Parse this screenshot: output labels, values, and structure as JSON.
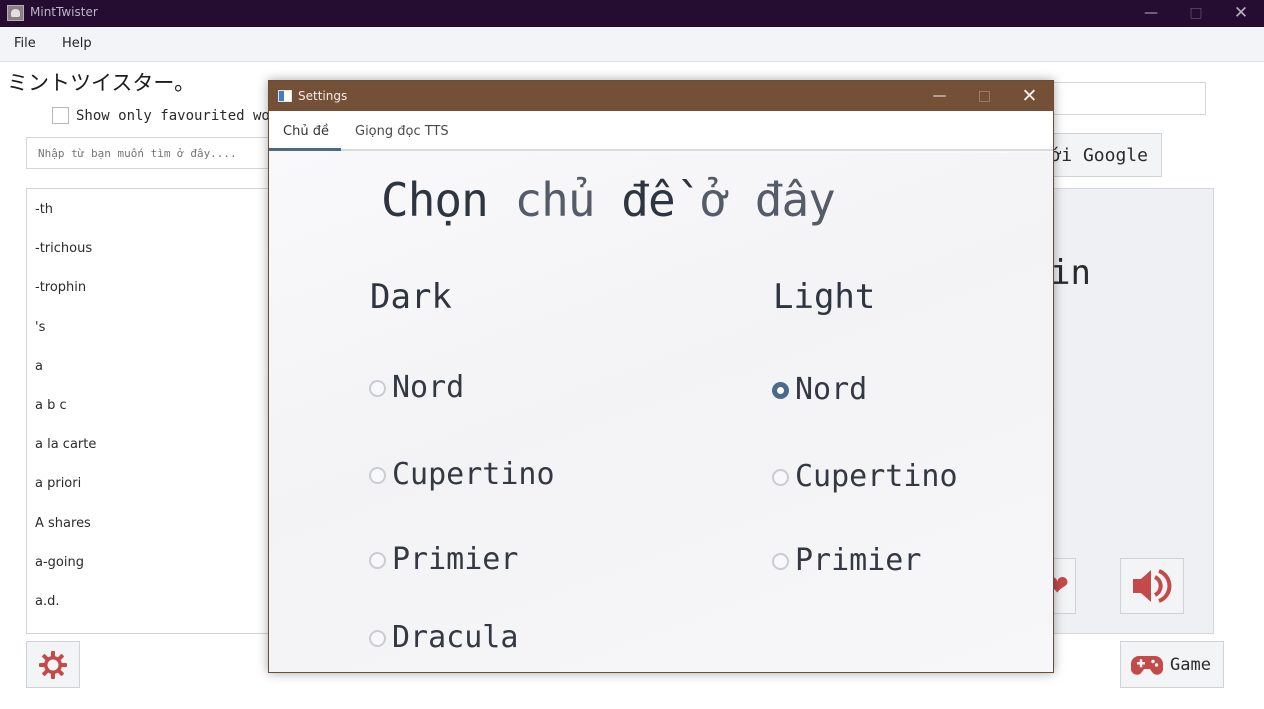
{
  "window": {
    "title": "MintTwister"
  },
  "menu": {
    "file": "File",
    "help": "Help"
  },
  "left_panel": {
    "logo": "ミントツイスター。",
    "favourite_label": "Show only favourited words",
    "search_placeholder": "Nhập từ bạn muốn tìm ở đây....",
    "words": [
      "-th",
      "-trichous",
      "-trophin",
      "'s",
      "a",
      "a b c",
      "a la carte",
      "a priori",
      "A shares",
      "a-going",
      "a.d."
    ]
  },
  "right_panel": {
    "google_button": "ới Google",
    "word_fragment": "in",
    "game_button": "Game"
  },
  "settings_dialog": {
    "title": "Settings",
    "tabs": [
      "Chủ đề",
      "Giọng đọc TTS"
    ],
    "active_tab": "Chủ đề",
    "heading_parts": [
      "Chọn",
      "chủ",
      "đề",
      "ở",
      "đây"
    ],
    "columns": {
      "dark": {
        "label": "Dark",
        "options": [
          {
            "label": "Nord",
            "selected": false
          },
          {
            "label": "Cupertino",
            "selected": false
          },
          {
            "label": "Primier",
            "selected": false
          },
          {
            "label": "Dracula",
            "selected": false
          }
        ]
      },
      "light": {
        "label": "Light",
        "options": [
          {
            "label": "Nord",
            "selected": true
          },
          {
            "label": "Cupertino",
            "selected": false
          },
          {
            "label": "Primier",
            "selected": false
          }
        ]
      }
    }
  },
  "colors": {
    "main_titlebar": "#250c31",
    "dialog_titlebar": "#745036",
    "radio_selected": "#4e6a8a",
    "icon_red": "#c44a4a",
    "theme_text": "#2e3440"
  },
  "icons": [
    "app-icon",
    "settings-gear-icon",
    "speaker-icon",
    "gamepad-icon",
    "heart-icon",
    "close-icon",
    "minimize-icon",
    "maximize-icon"
  ]
}
